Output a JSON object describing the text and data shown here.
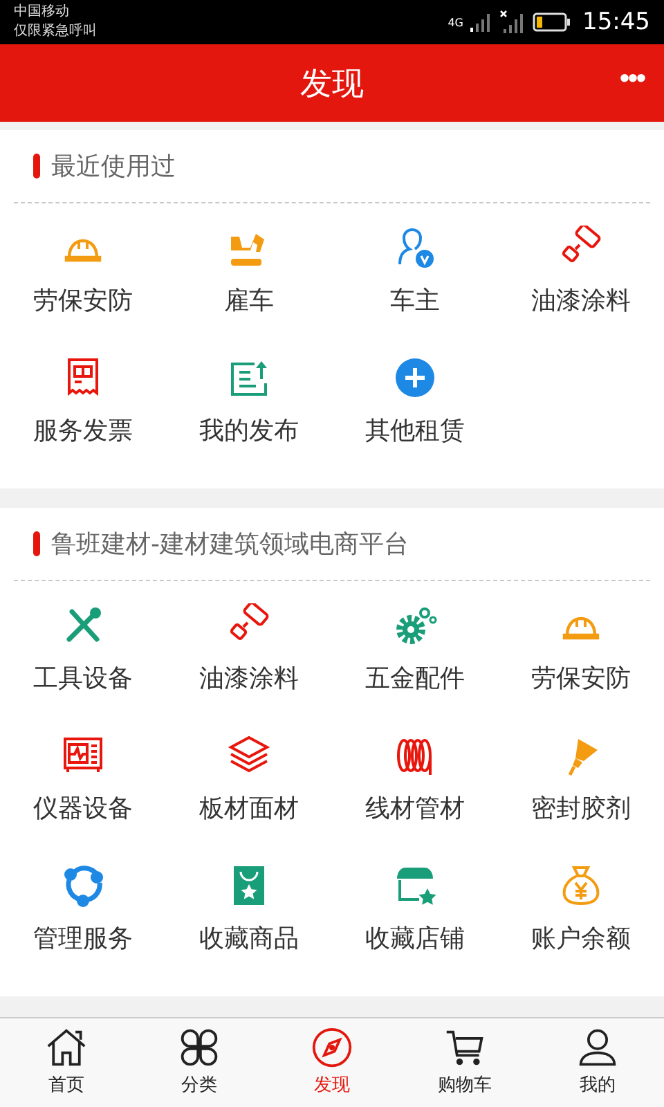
{
  "status_bar": {
    "carrier": "中国移动",
    "notice": "仅限紧急呼叫",
    "network": "4G",
    "time": "15:45"
  },
  "header": {
    "title": "发现",
    "menu": "•••"
  },
  "sections": [
    {
      "title": "最近使用过",
      "items": [
        {
          "label": "劳保安防",
          "kind": "helmet",
          "color": "#f39c12"
        },
        {
          "label": "雇车",
          "kind": "excavator",
          "color": "#f39c12"
        },
        {
          "label": "车主",
          "kind": "owner",
          "color": "#1e88e5"
        },
        {
          "label": "油漆涂料",
          "kind": "roller",
          "color": "#e8160c"
        },
        {
          "label": "服务发票",
          "kind": "invoice",
          "color": "#e8160c"
        },
        {
          "label": "我的发布",
          "kind": "publish",
          "color": "#1a9e7a"
        },
        {
          "label": "其他租赁",
          "kind": "plus",
          "color": "#1e88e5"
        }
      ]
    },
    {
      "title": "鲁班建材-建材建筑领域电商平台",
      "items": [
        {
          "label": "工具设备",
          "kind": "tools",
          "color": "#1a9e7a"
        },
        {
          "label": "油漆涂料",
          "kind": "roller",
          "color": "#e8160c"
        },
        {
          "label": "五金配件",
          "kind": "gears",
          "color": "#1a9e7a"
        },
        {
          "label": "劳保安防",
          "kind": "helmet",
          "color": "#f39c12"
        },
        {
          "label": "仪器设备",
          "kind": "instrument",
          "color": "#e8160c"
        },
        {
          "label": "板材面材",
          "kind": "layers",
          "color": "#e8160c"
        },
        {
          "label": "线材管材",
          "kind": "coil",
          "color": "#e8160c"
        },
        {
          "label": "密封胶剂",
          "kind": "sealant",
          "color": "#f39c12"
        },
        {
          "label": "管理服务",
          "kind": "share",
          "color": "#1e88e5"
        },
        {
          "label": "收藏商品",
          "kind": "bag",
          "color": "#1a9e7a"
        },
        {
          "label": "收藏店铺",
          "kind": "shop",
          "color": "#1a9e7a"
        },
        {
          "label": "账户余额",
          "kind": "moneybag",
          "color": "#f39c12"
        }
      ]
    }
  ],
  "nav": [
    {
      "label": "首页",
      "kind": "home",
      "selected": false
    },
    {
      "label": "分类",
      "kind": "category",
      "selected": false
    },
    {
      "label": "发现",
      "kind": "compass",
      "selected": true
    },
    {
      "label": "购物车",
      "kind": "cart",
      "selected": false
    },
    {
      "label": "我的",
      "kind": "user",
      "selected": false
    }
  ]
}
